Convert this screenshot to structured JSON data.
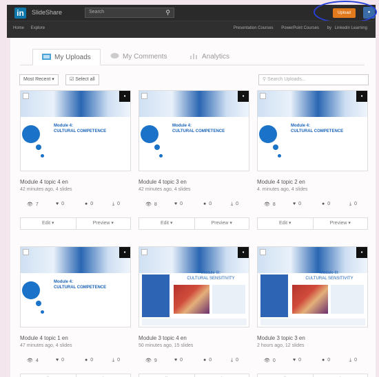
{
  "topbar": {
    "logo": "in",
    "brand": "SlideShare",
    "search_placeholder": "Search",
    "upload_label": "Upload"
  },
  "subnav": {
    "left": [
      "Home",
      "Explore"
    ],
    "right": [
      "Presentation Courses",
      "PowerPoint Courses",
      "by",
      "Linkedin Learning"
    ]
  },
  "tabs": [
    {
      "label": "My Uploads",
      "icon": "uploads-icon"
    },
    {
      "label": "My Comments",
      "icon": "comments-icon"
    },
    {
      "label": "Analytics",
      "icon": "analytics-icon"
    }
  ],
  "toolbar": {
    "sort_label": "Most Recent ▾",
    "select_all_label": "Select all",
    "search_placeholder": "Search Uploads..."
  },
  "cards": [
    {
      "thumb": "competence",
      "module_title": "Module 4:\nCULTURAL COMPETENCE",
      "title": "Module 4 topic 4 en",
      "meta": "42 minutes ago, 4 slides",
      "views": "7",
      "likes": "0",
      "comments": "0",
      "downloads": "0"
    },
    {
      "thumb": "competence",
      "module_title": "Module 4:\nCULTURAL COMPETENCE",
      "title": "Module 4 topic 3 en",
      "meta": "42 minutes ago, 4 slides",
      "views": "8",
      "likes": "0",
      "comments": "0",
      "downloads": "0"
    },
    {
      "thumb": "competence",
      "module_title": "Module 4:\nCULTURAL COMPETENCE",
      "title": "Module 4 topic 2 en",
      "meta": "4. minutes ago, 4 slides",
      "views": "8",
      "likes": "0",
      "comments": "0",
      "downloads": "0"
    },
    {
      "thumb": "competence",
      "module_title": "Module 4:\nCULTURAL COMPETENCE",
      "title": "Module 4 topic 1 en",
      "meta": "47 minutes ago, 4 slides",
      "views": "4",
      "likes": "0",
      "comments": "0",
      "downloads": "0"
    },
    {
      "thumb": "sensitivity",
      "module_title": "Module III:\nCULTURAL SENSITIVITY",
      "title": "Module 3 topic 4 en",
      "meta": "50 minutes ago, 15 slides",
      "views": "9",
      "likes": "0",
      "comments": "0",
      "downloads": "0"
    },
    {
      "thumb": "sensitivity",
      "module_title": "Module III:\nCULTURAL SENSITIVITY",
      "title": "Module 3 topic 3 en",
      "meta": "2 hours ago, 12 slides",
      "views": "0",
      "likes": "0",
      "comments": "0",
      "downloads": "0"
    }
  ],
  "card_actions": {
    "edit": "Edit ▾",
    "preview": "Preview ▾"
  }
}
